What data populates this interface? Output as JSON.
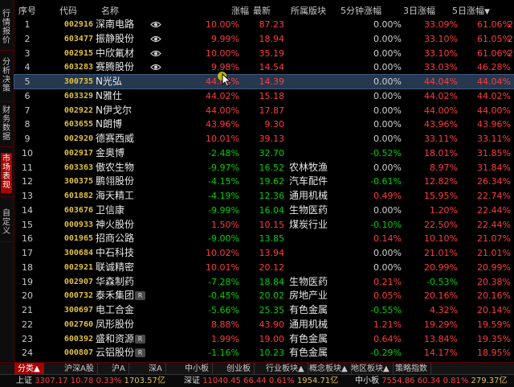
{
  "sidebar": {
    "items": [
      {
        "label": "行情报价",
        "active": false
      },
      {
        "label": "分析决策",
        "active": false
      },
      {
        "label": "财务数据",
        "active": false
      },
      {
        "label": "市场表现",
        "active": true
      },
      {
        "label": "自定义",
        "active": false
      }
    ]
  },
  "table": {
    "headers": {
      "seq": "序号",
      "code": "代码",
      "name": "名称",
      "pct": "涨幅",
      "price": "最新",
      "industry": "所属版块",
      "m5": "5分钟涨幅",
      "d3": "3日涨幅",
      "d5": "5日涨幅",
      "d5_sort": "▼"
    },
    "rows": [
      {
        "seq": "1",
        "code": "002916",
        "name": "深南电路",
        "eye": true,
        "r": false,
        "pct": "10.00%",
        "pct_dir": "up",
        "price": "87.23",
        "price_dir": "up",
        "industry": "",
        "m5": "0.00%",
        "m5_dir": "fl",
        "d3": "33.09%",
        "d5": "61.06%",
        "cut": "2"
      },
      {
        "seq": "2",
        "code": "603477",
        "name": "振静股份",
        "eye": true,
        "r": false,
        "pct": "9.99%",
        "pct_dir": "up",
        "price": "18.94",
        "price_dir": "up",
        "industry": "",
        "m5": "0.00%",
        "m5_dir": "fl",
        "d3": "33.10%",
        "d5": "61.05%",
        "cut": "2"
      },
      {
        "seq": "3",
        "code": "002915",
        "name": "中欣氟材",
        "eye": true,
        "r": false,
        "pct": "10.00%",
        "pct_dir": "up",
        "price": "35.19",
        "price_dir": "up",
        "industry": "",
        "m5": "0.00%",
        "m5_dir": "fl",
        "d3": "33.10%",
        "d5": "61.06%",
        "cut": "2"
      },
      {
        "seq": "4",
        "code": "603283",
        "name": "赛腾股份",
        "eye": true,
        "r": false,
        "pct": "9.98%",
        "pct_dir": "up",
        "price": "14.54",
        "price_dir": "up",
        "industry": "",
        "m5": "0.00%",
        "m5_dir": "fl",
        "d3": "33.03%",
        "d5": "46.28%",
        "cut": ""
      },
      {
        "seq": "5",
        "code": "300735",
        "name": "N光弘",
        "eye": false,
        "r": false,
        "pct": "44.04%",
        "pct_dir": "up",
        "price": "14.39",
        "price_dir": "up",
        "industry": "",
        "m5": "0.00%",
        "m5_dir": "fl",
        "d3": "44.04%",
        "d5": "44.04%",
        "cut": ""
      },
      {
        "seq": "6",
        "code": "603329",
        "name": "N雅仕",
        "eye": false,
        "r": false,
        "pct": "44.02%",
        "pct_dir": "up",
        "price": "15.18",
        "price_dir": "up",
        "industry": "",
        "m5": "0.00%",
        "m5_dir": "fl",
        "d3": "44.02%",
        "d5": "44.02%",
        "cut": ""
      },
      {
        "seq": "7",
        "code": "002922",
        "name": "N伊戈尔",
        "eye": false,
        "r": false,
        "pct": "44.00%",
        "pct_dir": "up",
        "price": "17.87",
        "price_dir": "up",
        "industry": "",
        "m5": "0.00%",
        "m5_dir": "fl",
        "d3": "44.00%",
        "d5": "44.00%",
        "cut": ""
      },
      {
        "seq": "8",
        "code": "603655",
        "name": "N朗博",
        "eye": false,
        "r": false,
        "pct": "43.96%",
        "pct_dir": "up",
        "price": "9.30",
        "price_dir": "up",
        "industry": "",
        "m5": "0.00%",
        "m5_dir": "fl",
        "d3": "43.96%",
        "d5": "43.96%",
        "cut": ""
      },
      {
        "seq": "9",
        "code": "002920",
        "name": "德赛西威",
        "eye": false,
        "r": false,
        "pct": "10.01%",
        "pct_dir": "up",
        "price": "39.13",
        "price_dir": "up",
        "industry": "",
        "m5": "0.00%",
        "m5_dir": "fl",
        "d3": "33.11%",
        "d5": "33.11%",
        "cut": ""
      },
      {
        "seq": "10",
        "code": "002917",
        "name": "金奥博",
        "eye": false,
        "r": false,
        "pct": "-2.48%",
        "pct_dir": "dn",
        "price": "32.70",
        "price_dir": "dn",
        "industry": "",
        "m5": "-0.52%",
        "m5_dir": "dn",
        "d3": "18.01%",
        "d5": "31.85%",
        "cut": ""
      },
      {
        "seq": "11",
        "code": "603363",
        "name": "傲农生物",
        "eye": false,
        "r": false,
        "pct": "-9.97%",
        "pct_dir": "dn",
        "price": "16.52",
        "price_dir": "dn",
        "industry": "农林牧渔",
        "m5": "0.00%",
        "m5_dir": "fl",
        "d3": "8.97%",
        "d5": "31.84%",
        "cut": ""
      },
      {
        "seq": "12",
        "code": "300375",
        "name": "鹏翎股份",
        "eye": false,
        "r": false,
        "pct": "-4.15%",
        "pct_dir": "dn",
        "price": "19.62",
        "price_dir": "dn",
        "industry": "汽车配件",
        "m5": "-0.61%",
        "m5_dir": "dn",
        "d3": "12.82%",
        "d5": "26.34%",
        "cut": ""
      },
      {
        "seq": "13",
        "code": "601882",
        "name": "海天精工",
        "eye": false,
        "r": false,
        "pct": "-4.19%",
        "pct_dir": "dn",
        "price": "12.36",
        "price_dir": "dn",
        "industry": "通用机械",
        "m5": "0.49%",
        "m5_dir": "up",
        "d3": "15.95%",
        "d5": "22.74%",
        "cut": ""
      },
      {
        "seq": "14",
        "code": "603676",
        "name": "卫信康",
        "eye": false,
        "r": false,
        "pct": "-9.99%",
        "pct_dir": "dn",
        "price": "16.04",
        "price_dir": "dn",
        "industry": "生物医药",
        "m5": "0.00%",
        "m5_dir": "fl",
        "d3": "1.20%",
        "d5": "22.44%",
        "cut": ""
      },
      {
        "seq": "15",
        "code": "000933",
        "name": "神火股份",
        "eye": false,
        "r": false,
        "pct": "1.50%",
        "pct_dir": "up",
        "price": "10.15",
        "price_dir": "up",
        "industry": "煤炭行业",
        "m5": "-0.10%",
        "m5_dir": "dn",
        "d3": "22.50%",
        "d5": "22.44%",
        "cut": ""
      },
      {
        "seq": "16",
        "code": "001965",
        "name": "招商公路",
        "eye": false,
        "r": false,
        "pct": "-9.00%",
        "pct_dir": "dn",
        "price": "13.85",
        "price_dir": "dn",
        "industry": "",
        "m5": "0.14%",
        "m5_dir": "up",
        "d3": "10.10%",
        "d5": "21.07%",
        "cut": ""
      },
      {
        "seq": "17",
        "code": "300684",
        "name": "中石科技",
        "eye": false,
        "r": false,
        "pct": "10.02%",
        "pct_dir": "up",
        "price": "13.94",
        "price_dir": "up",
        "industry": "",
        "m5": "0.00%",
        "m5_dir": "fl",
        "d3": "21.01%",
        "d5": "21.01%",
        "cut": ""
      },
      {
        "seq": "18",
        "code": "002921",
        "name": "联诚精密",
        "eye": false,
        "r": false,
        "pct": "10.01%",
        "pct_dir": "up",
        "price": "20.12",
        "price_dir": "up",
        "industry": "",
        "m5": "0.00%",
        "m5_dir": "fl",
        "d3": "20.99%",
        "d5": "20.99%",
        "cut": ""
      },
      {
        "seq": "19",
        "code": "002907",
        "name": "华森制药",
        "eye": false,
        "r": false,
        "pct": "-7.28%",
        "pct_dir": "dn",
        "price": "18.84",
        "price_dir": "dn",
        "industry": "生物医药",
        "m5": "0.21%",
        "m5_dir": "up",
        "d3": "-0.53%",
        "d5": "20.38%",
        "cut": ""
      },
      {
        "seq": "20",
        "code": "000732",
        "name": "泰禾集团",
        "eye": false,
        "r": true,
        "pct": "-0.45%",
        "pct_dir": "dn",
        "price": "20.02",
        "price_dir": "dn",
        "industry": "房地产业",
        "m5": "0.05%",
        "m5_dir": "up",
        "d3": "20.16%",
        "d5": "20.16%",
        "cut": ""
      },
      {
        "seq": "21",
        "code": "300697",
        "name": "电工合金",
        "eye": false,
        "r": false,
        "pct": "-5.66%",
        "pct_dir": "dn",
        "price": "25.35",
        "price_dir": "dn",
        "industry": "有色金属",
        "m5": "-0.55%",
        "m5_dir": "dn",
        "d3": "4.32%",
        "d5": "20.14%",
        "cut": ""
      },
      {
        "seq": "22",
        "code": "002760",
        "name": "凤形股份",
        "eye": false,
        "r": false,
        "pct": "8.88%",
        "pct_dir": "up",
        "price": "43.90",
        "price_dir": "up",
        "industry": "通用机械",
        "m5": "1.21%",
        "m5_dir": "up",
        "d3": "19.29%",
        "d5": "19.59%",
        "cut": ""
      },
      {
        "seq": "23",
        "code": "600392",
        "name": "盛和资源",
        "eye": false,
        "r": true,
        "pct": "1.99%",
        "pct_dir": "up",
        "price": "19.00",
        "price_dir": "up",
        "industry": "有色金属",
        "m5": "0.64%",
        "m5_dir": "up",
        "d3": "13.84%",
        "d5": "19.35%",
        "cut": ""
      },
      {
        "seq": "24",
        "code": "000807",
        "name": "云铝股份",
        "eye": false,
        "r": true,
        "pct": "-1.16%",
        "pct_dir": "dn",
        "price": "10.23",
        "price_dir": "dn",
        "industry": "有色金属",
        "m5": "-0.29%",
        "m5_dir": "dn",
        "d3": "14.17%",
        "d5": "18.95%",
        "cut": ""
      }
    ],
    "selected_row": "5",
    "r_badge": "R"
  },
  "tabs": [
    {
      "label": "分类▲",
      "active": true
    },
    {
      "label": "沪深A股",
      "active": false
    },
    {
      "label": "沪A",
      "active": false
    },
    {
      "label": "深A",
      "active": false
    },
    {
      "label": "中小板",
      "active": false
    },
    {
      "label": "创业板",
      "active": false
    },
    {
      "label": "行业板块▲",
      "active": false
    },
    {
      "label": "概念板块▲",
      "active": false
    },
    {
      "label": "地区板块▲",
      "active": false
    },
    {
      "label": "策略指数",
      "active": false
    }
  ],
  "status": {
    "sh": {
      "label": "上证",
      "index": "3307.17",
      "chg": "10.78",
      "pct": "0.33%",
      "amount": "1703.57亿"
    },
    "sz": {
      "label": "深证",
      "index": "11040.45",
      "chg": "66.44",
      "pct": "0.61%",
      "amount": "1954.71亿"
    },
    "zx": {
      "label": "中小板",
      "index": "7554.86",
      "chg": "60.34",
      "pct": "0.81%",
      "amount": "279.37亿"
    }
  },
  "colors": {
    "up": "#ff3c3c",
    "down": "#00d000",
    "flat": "#d0d0d0",
    "code": "#e0c040",
    "accent": "#a80000",
    "selected": "#25384f"
  },
  "icons": {
    "eye": "eye-icon",
    "cursor": "mouse-pointer-icon"
  }
}
